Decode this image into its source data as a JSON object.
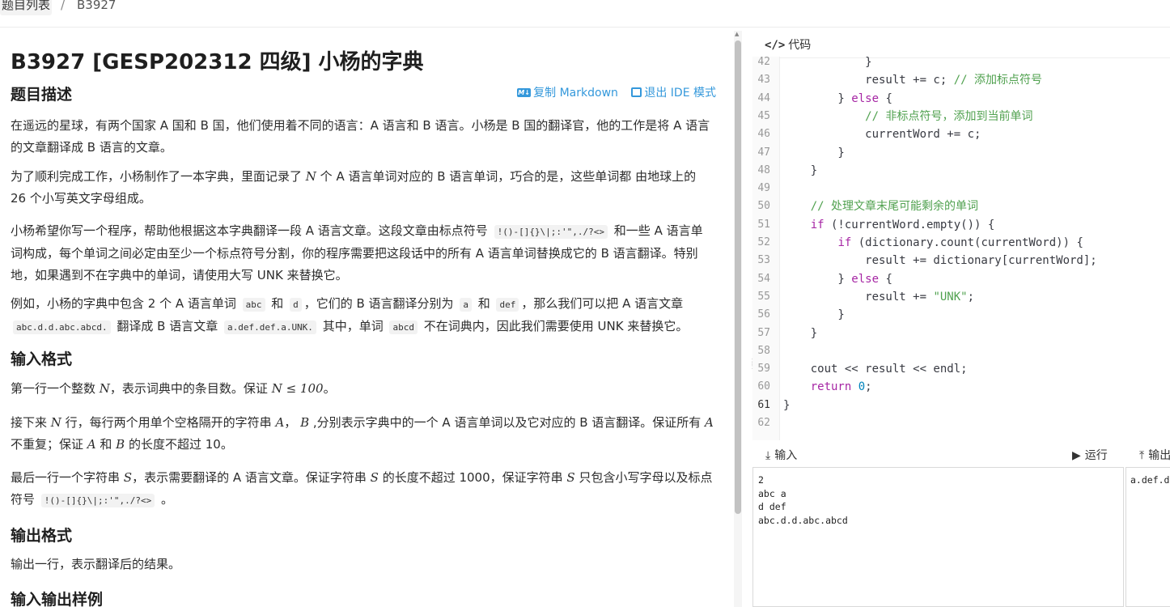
{
  "breadcrumb": {
    "list": "题目列表",
    "sep": "/",
    "current": "B3927"
  },
  "problem": {
    "title": "B3927 [GESP202312 四级] 小杨的字典",
    "actions": {
      "copy_md": "复制 Markdown",
      "exit_ide": "退出 IDE 模式"
    },
    "sections": {
      "desc": "题目描述",
      "input": "输入格式",
      "output": "输出格式",
      "sample": "输入输出样例"
    },
    "p1": "在遥远的星球，有两个国家 A 国和 B 国，他们使用着不同的语言：A 语言和 B 语言。小杨是 B 国的翻译官，他的工作是将 A 语言的文章翻译成 B 语言的文章。",
    "p2a": "为了顺利完成工作，小杨制作了一本字典，里面记录了 ",
    "p2b": " 个 A 语言单词对应的 B 语言单词，巧合的是，这些单词都 由地球上的 26 个小写英文字母组成。",
    "p3a": "小杨希望你写一个程序，帮助他根据这本字典翻译一段 A 语言文章。这段文章由标点符号 ",
    "punct": "!()-[]{}\\|;:'\",./?<>",
    "p3b": " 和一些 A 语言单词构成，每个单词之间必定由至少一个标点符号分割，你的程序需要把这段话中的所有 A 语言单词替换成它的 B 语言翻译。特别地，如果遇到不在字典中的单词，请使用大写 UNK 来替换它。",
    "p4": {
      "t1": "例如，小杨的字典中包含 2 个 A 语言单词 ",
      "c1": "abc",
      "t2": " 和 ",
      "c2": "d",
      "t3": "，它们的 B 语言翻译分别为 ",
      "c3": "a",
      "t4": " 和 ",
      "c4": "def",
      "t5": "，那么我们可以把 A 语言文章 ",
      "c5": "abc.d.d.abc.abcd.",
      "t6": " 翻译成 B 语言文章 ",
      "c6": "a.def.def.a.UNK.",
      "t7": " 其中，单词 ",
      "c7": "abcd",
      "t8": " 不在词典内，因此我们需要使用 UNK 来替换它。"
    },
    "in1": {
      "t1": "第一行一个整数 ",
      "m1": "N",
      "t2": "，表示词典中的条目数。保证 ",
      "m2": "N ≤ 100",
      "t3": "。"
    },
    "in2": {
      "t1": "接下来 ",
      "m1": "N",
      "t2": " 行，每行两个用单个空格隔开的字符串 ",
      "m2": "A",
      "t3": "， ",
      "m3": "B",
      "t4": " ,分别表示字典中的一个 A 语言单词以及它对应的 B 语言翻译。保证所有 ",
      "m4": "A",
      "t5": " 不重复；保证 ",
      "m5": "A",
      "t6": " 和 ",
      "m6": "B",
      "t7": " 的长度不超过 10。"
    },
    "in3": {
      "t1": "最后一行一个字符串 ",
      "m1": "S",
      "t2": "，表示需要翻译的 A 语言文章。保证字符串 ",
      "m2": "S",
      "t3": " 的长度不超过 1000，保证字符串 ",
      "m3": "S",
      "t4": " 只包含小写字母以及标点符号 ",
      "t5": " 。"
    },
    "out1": "输出一行，表示翻译后的结果。",
    "N": "N"
  },
  "editor": {
    "label": "代码",
    "lines": [
      {
        "n": "42",
        "code": "            }"
      },
      {
        "n": "43",
        "code": "            result += c; // 添加标点符号"
      },
      {
        "n": "44",
        "code": "        } else {"
      },
      {
        "n": "45",
        "code": "            // 非标点符号，添加到当前单词"
      },
      {
        "n": "46",
        "code": "            currentWord += c;"
      },
      {
        "n": "47",
        "code": "        }"
      },
      {
        "n": "48",
        "code": "    }"
      },
      {
        "n": "49",
        "code": ""
      },
      {
        "n": "50",
        "code": "    // 处理文章末尾可能剩余的单词"
      },
      {
        "n": "51",
        "code": "    if (!currentWord.empty()) {"
      },
      {
        "n": "52",
        "code": "        if (dictionary.count(currentWord)) {"
      },
      {
        "n": "53",
        "code": "            result += dictionary[currentWord];"
      },
      {
        "n": "54",
        "code": "        } else {"
      },
      {
        "n": "55",
        "code": "            result += \"UNK\";"
      },
      {
        "n": "56",
        "code": "        }"
      },
      {
        "n": "57",
        "code": "    }"
      },
      {
        "n": "58",
        "code": ""
      },
      {
        "n": "59",
        "code": "    cout << result << endl;"
      },
      {
        "n": "60",
        "code": "    return 0;"
      },
      {
        "n": "61",
        "code": "}"
      },
      {
        "n": "62",
        "code": ""
      }
    ]
  },
  "io": {
    "input_label": "输入",
    "run_label": "运行",
    "output_label": "输出",
    "input_value": "2\nabc a\nd def\nabc.d.d.abc.abcd",
    "output_value": "a.def.d"
  },
  "colors": {
    "accent": "#3498db",
    "keyword": "#a626a4",
    "comment": "#50a14f"
  }
}
